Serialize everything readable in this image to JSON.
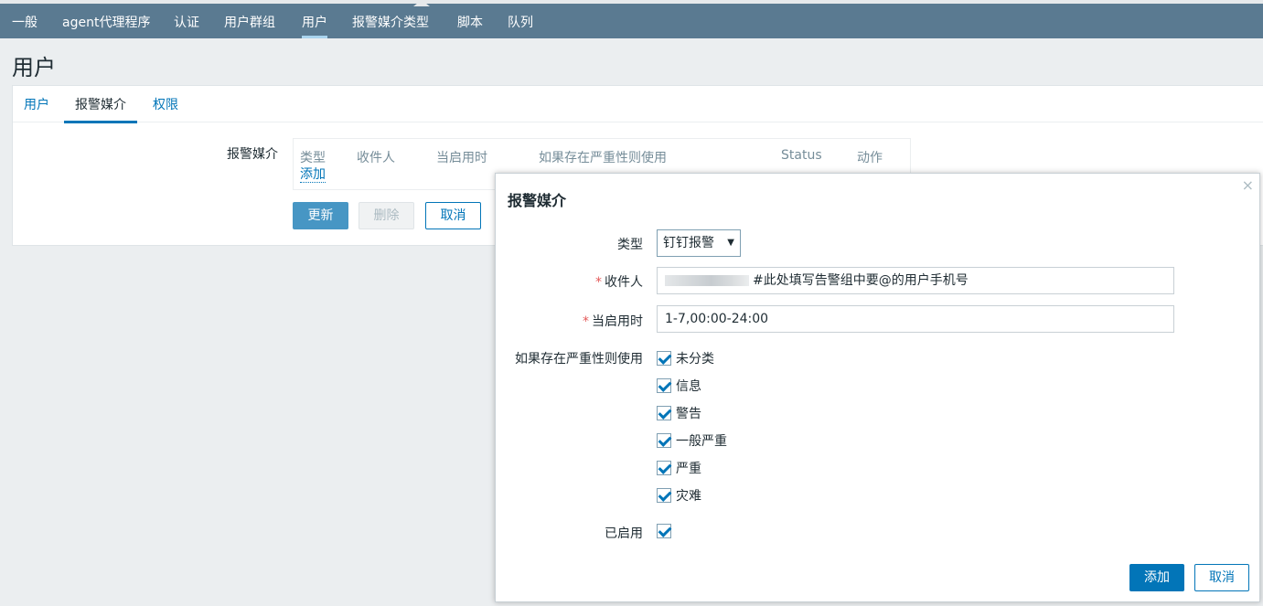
{
  "nav": {
    "items": [
      "一般",
      "agent代理程序",
      "认证",
      "用户群组",
      "用户",
      "报警媒介类型",
      "脚本",
      "队列"
    ]
  },
  "page": {
    "title": "用户"
  },
  "tabs": [
    "用户",
    "报警媒介",
    "权限"
  ],
  "media": {
    "label": "报警媒介",
    "headers": [
      "类型",
      "收件人",
      "当启用时",
      "如果存在严重性则使用",
      "Status",
      "动作"
    ],
    "add_link": "添加"
  },
  "form_buttons": {
    "update": "更新",
    "delete": "删除",
    "cancel": "取消"
  },
  "dialog": {
    "title": "报警媒介",
    "close_icon": "×",
    "type_label": "类型",
    "type_value": "钉钉报警",
    "type_caret": "▼",
    "required_mark": "*",
    "recipient_label": "收件人",
    "recipient_value": "#此处填写告警组中要@的用户手机号",
    "when_label": "当启用时",
    "when_value": "1-7,00:00-24:00",
    "severity_label": "如果存在严重性则使用",
    "severities": [
      "未分类",
      "信息",
      "警告",
      "一般严重",
      "严重",
      "灾难"
    ],
    "enabled_label": "已启用",
    "add_button": "添加",
    "cancel_button": "取消"
  },
  "colors": {
    "header": "#5a7a91",
    "primary": "#0275b8",
    "required": "#e45959"
  }
}
